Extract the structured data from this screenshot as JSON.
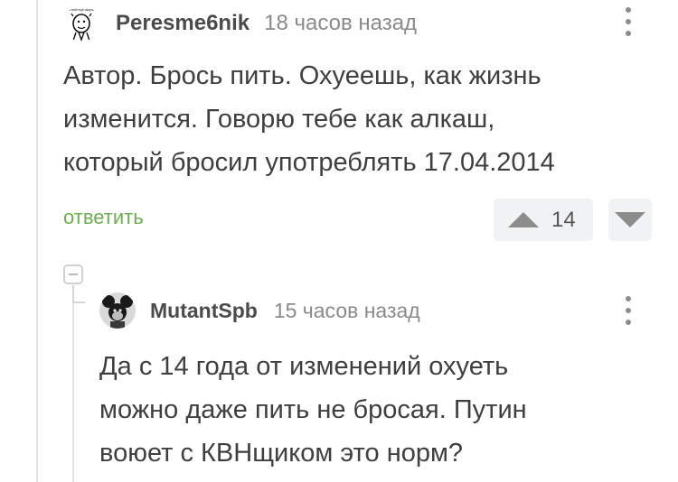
{
  "comment": {
    "username": "Peresme6nik",
    "timestamp": "18 часов назад",
    "avatar_text": "на свой ещё смирись",
    "lines": [
      "Автор. Брось пить. Охуеешь, как жизнь",
      "изменится. Говорю тебе как алкаш,",
      "который бросил употреблять 17.04.2014"
    ],
    "reply_label": "ответить",
    "rating": "14"
  },
  "reply": {
    "username": "MutantSpb",
    "timestamp": "15 часов назад",
    "lines": [
      "Да с 14 года от изменений охуеть",
      "можно даже пить не бросая. Путин",
      "воюет с КВНщиком это норм?"
    ]
  },
  "colors": {
    "reply_link": "#6cae4f",
    "vote_bg": "#f1f2f4",
    "icon_gray": "#8c8c8c"
  }
}
